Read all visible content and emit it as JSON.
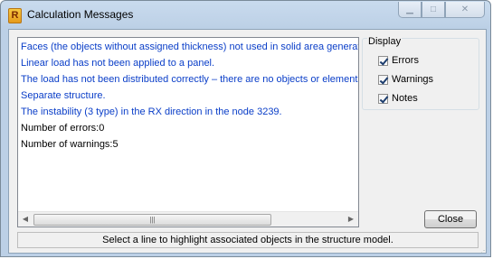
{
  "window": {
    "title": "Calculation Messages",
    "app_icon_letter": "R",
    "controls": {
      "minimize": "minimize-icon",
      "maximize": "maximize-icon",
      "close": "close-icon"
    }
  },
  "messages": [
    {
      "text": "Faces (the objects without assigned thickness) not used in solid area generati",
      "color": "#0a3ec8"
    },
    {
      "text": "Linear load has not been applied to a panel.",
      "color": "#0a3ec8"
    },
    {
      "text": "The load has not been distributed correctly – there are no objects or elements",
      "color": "#0a3ec8"
    },
    {
      "text": "Separate structure.",
      "color": "#0a3ec8"
    },
    {
      "text": "The instability (3 type) in the RX direction in the node 3239.",
      "color": "#0a3ec8"
    },
    {
      "text": "Number of errors:0",
      "color": "#000000"
    },
    {
      "text": "Number of warnings:5",
      "color": "#000000"
    }
  ],
  "display": {
    "label": "Display",
    "errors": {
      "label": "Errors",
      "checked": true
    },
    "warnings": {
      "label": "Warnings",
      "checked": true
    },
    "notes": {
      "label": "Notes",
      "checked": true
    }
  },
  "close_button": "Close",
  "status_text": "Select a line to highlight associated objects in the structure model."
}
